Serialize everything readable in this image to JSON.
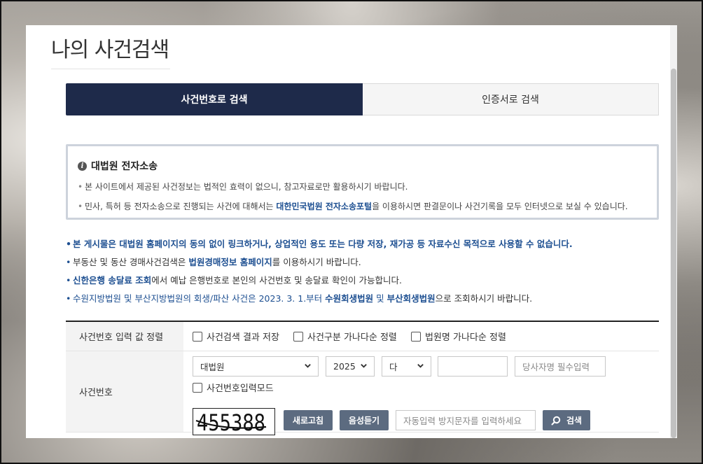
{
  "page": {
    "title": "나의 사건검색"
  },
  "tabs": [
    {
      "label": "사건번호로 검색",
      "active": true
    },
    {
      "label": "인증서로 검색",
      "active": false
    }
  ],
  "notice": {
    "title": "대법원 전자소송",
    "line1": "본 사이트에서 제공된 사건정보는 법적인 효력이 없으니, 참고자료로만 활용하시기 바랍니다.",
    "line2_pre": "민사, 특허 등 전자소송으로 진행되는 사건에 대해서는 ",
    "line2_link": "대한민국법원 전자소송포털",
    "line2_post": "을 이용하시면 판결문이나 사건기록을 모두 인터넷으로 보실 수 있습니다."
  },
  "info": {
    "item1": "본 게시물은 대법원 홈페이지의 동의 없이 링크하거나, 상업적인 용도 또는 다량 저장, 재가공 등 자료수신 목적으로 사용할 수 없습니다.",
    "item2_pre": "부동산 및 동산 경매사건검색은 ",
    "item2_link": "법원경매정보 홈페이지",
    "item2_post": "를 이용하시기 바랍니다.",
    "item3_link": "신한은행 송달료 조회",
    "item3_post": "에서 예납 은행번호로 본인의 사건번호 및 송달료 확인이 가능합니다.",
    "item4_pre": "수원지방법원 및 부산지방법원의 회생/파산 사건은 2023. 3. 1.부터 ",
    "item4_link1": "수원회생법원",
    "item4_mid": " 및 ",
    "item4_link2": "부산회생법원",
    "item4_post": "으로 조회하시기 바랍니다."
  },
  "form": {
    "sort_label": "사건번호 입력 값 정렬",
    "sort_options": [
      "사건검색 결과 저장",
      "사건구분 가나다순 정렬",
      "법원명 가나다순 정렬"
    ],
    "case_label": "사건번호",
    "court_value": "대법원",
    "year_value": "2025",
    "case_type_value": "다",
    "case_number_value": "",
    "party_placeholder": "당사자명 필수입력",
    "input_mode_label": "사건번호입력모드",
    "captcha_text": "455388",
    "refresh_label": "새로고침",
    "audio_label": "음성듣기",
    "captcha_placeholder": "자동입력 방지문자를 입력하세요",
    "search_label": "검색"
  }
}
